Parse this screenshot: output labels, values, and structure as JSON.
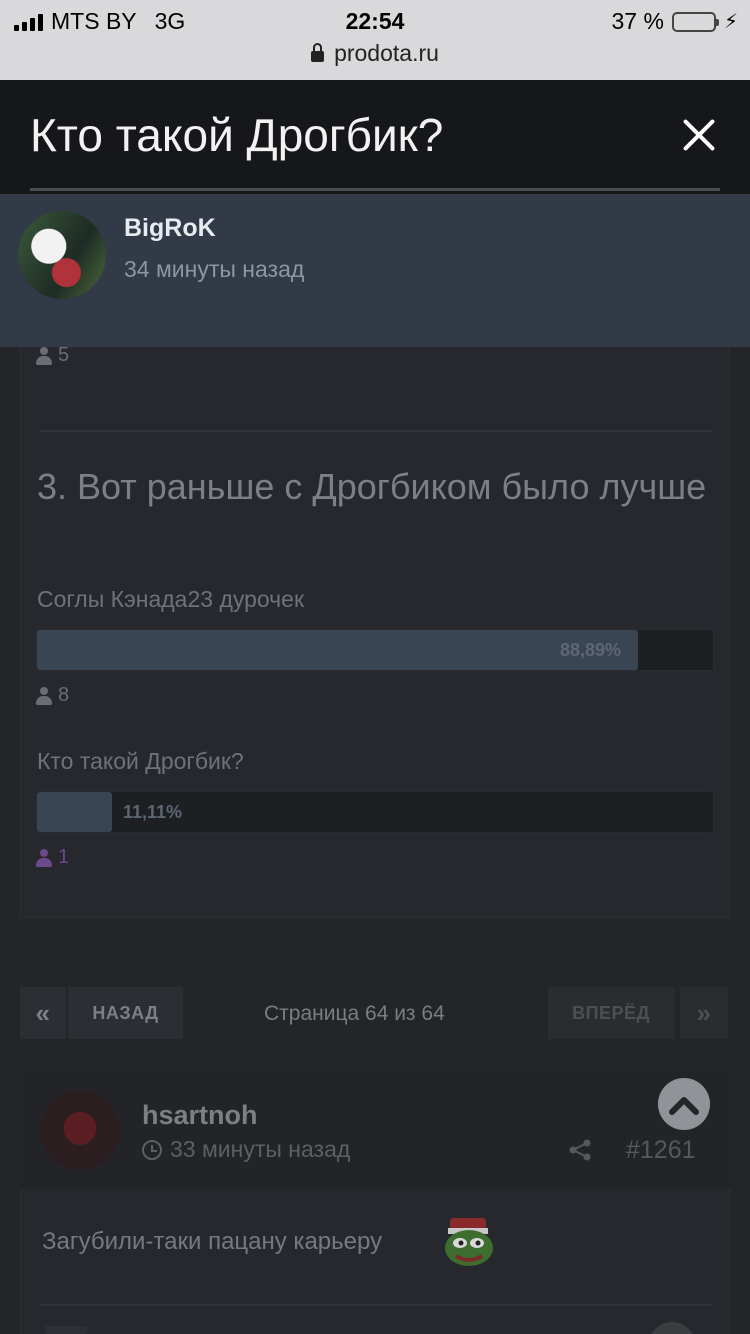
{
  "status_bar": {
    "carrier": "MTS BY",
    "network": "3G",
    "time": "22:54",
    "battery": "37 %",
    "battery_level": 0.37,
    "url": "prodota.ru"
  },
  "modal": {
    "title": "Кто такой Дрогбик?"
  },
  "voter": {
    "name": "BigRoK",
    "time": "34 минуты назад"
  },
  "poll": {
    "previous_count": "5",
    "question": "3. Вот раньше с Дрогбиком было лучше",
    "options": [
      {
        "label": "Соглы Кэнада23 дурочек",
        "percent_text": "88,89%",
        "fraction": 0.8889,
        "voters": "8"
      },
      {
        "label": "Кто такой Дрогбик?",
        "percent_text": "11,11%",
        "fraction": 0.1111,
        "voters": "1"
      }
    ]
  },
  "pagination": {
    "first": "«",
    "prev": "НАЗАД",
    "info": "Страница 64 из 64",
    "next": "ВПЕРЁД",
    "last": "»"
  },
  "post": {
    "author": "hsartnoh",
    "time": "33 минуты назад",
    "number": "#1261",
    "text": "Загубили-таки пацану карьеру"
  },
  "colors": {
    "accent_bar": "#3a4553",
    "modal_header": "#15171a",
    "voter_row": "#323a47",
    "battery": "#4cd964"
  }
}
